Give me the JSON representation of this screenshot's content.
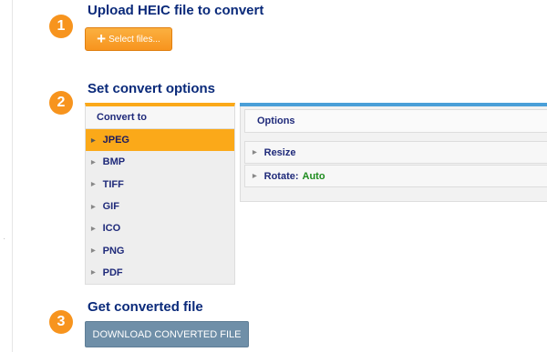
{
  "steps": [
    {
      "number": "1",
      "title": "Upload HEIC file to convert"
    },
    {
      "number": "2",
      "title": "Set convert options"
    },
    {
      "number": "3",
      "title": "Get converted file"
    }
  ],
  "upload": {
    "select_label": "Select files..."
  },
  "convert_to": {
    "header": "Convert to",
    "formats": [
      "JPEG",
      "BMP",
      "TIFF",
      "GIF",
      "ICO",
      "PNG",
      "PDF"
    ],
    "selected": "JPEG"
  },
  "options": {
    "header": "Options",
    "resize_label": "Resize",
    "rotate_label": "Rotate:",
    "rotate_value": "Auto"
  },
  "download": {
    "label": "DOWNLOAD CONVERTED FILE"
  },
  "colors": {
    "accent": "#f7941e",
    "heading": "#0a2a7a",
    "selected_format": "#fba919",
    "options_bar": "#4a9fd8",
    "download_button": "#6f8fa8",
    "rotate_value": "#1e8c1e"
  }
}
